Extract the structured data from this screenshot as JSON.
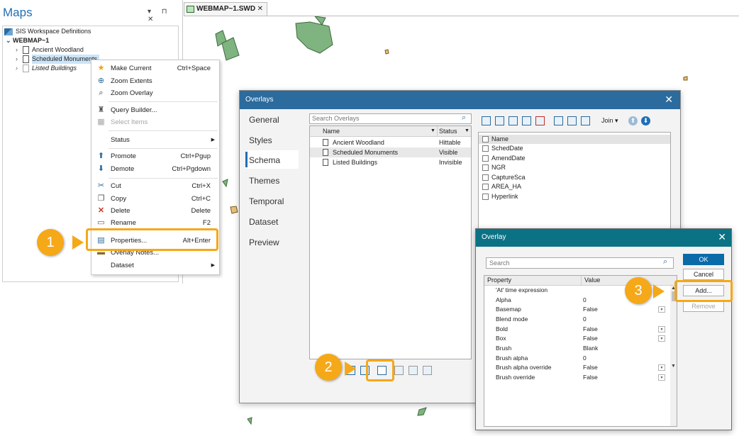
{
  "maps_panel": {
    "title": "Maps",
    "controls": "▾ ⊓ ✕",
    "tree": {
      "root": "SIS Workspace Definitions",
      "map": "WEBMAP~1",
      "items": [
        "Ancient Woodland",
        "Scheduled Monuments",
        "Listed Buildings"
      ]
    }
  },
  "map_view": {
    "tab_label": "WEBMAP~1.SWD",
    "tab_close": "✕"
  },
  "context_menu": {
    "items": [
      {
        "label": "Make Current",
        "shortcut": "Ctrl+Space",
        "icon": "★"
      },
      {
        "label": "Zoom Extents",
        "shortcut": "",
        "icon": "⊕"
      },
      {
        "label": "Zoom Overlay",
        "shortcut": "",
        "icon": "⌕"
      },
      {
        "label": "Query Builder...",
        "shortcut": "",
        "icon": "♜"
      },
      {
        "label": "Select Items",
        "shortcut": "",
        "icon": "▦"
      },
      {
        "label": "Status",
        "shortcut": "",
        "icon": ""
      },
      {
        "label": "Promote",
        "shortcut": "Ctrl+Pgup",
        "icon": "⬆"
      },
      {
        "label": "Demote",
        "shortcut": "Ctrl+Pgdown",
        "icon": "⬇"
      },
      {
        "label": "Cut",
        "shortcut": "Ctrl+X",
        "icon": "✂"
      },
      {
        "label": "Copy",
        "shortcut": "Ctrl+C",
        "icon": "❐"
      },
      {
        "label": "Delete",
        "shortcut": "Delete",
        "icon": "✕"
      },
      {
        "label": "Rename",
        "shortcut": "F2",
        "icon": "▭"
      },
      {
        "label": "Properties...",
        "shortcut": "Alt+Enter",
        "icon": "▤"
      },
      {
        "label": "Overlay Notes...",
        "shortcut": "",
        "icon": "▬"
      },
      {
        "label": "Dataset",
        "shortcut": "",
        "icon": ""
      }
    ]
  },
  "overlays_dialog": {
    "title": "Overlays",
    "close": "✕",
    "nav": [
      "General",
      "Styles",
      "Schema",
      "Themes",
      "Temporal",
      "Dataset",
      "Preview"
    ],
    "search_placeholder": "Search Overlays",
    "columns": [
      "Name",
      "Status"
    ],
    "rows": [
      {
        "name": "Ancient Woodland",
        "status": "Hittable"
      },
      {
        "name": "Scheduled Monuments",
        "status": "Visible"
      },
      {
        "name": "Listed Buildings",
        "status": "Invisible"
      }
    ],
    "join_label": "Join",
    "fields": [
      "Name",
      "SchedDate",
      "AmendDate",
      "NGR",
      "CaptureSca",
      "AREA_HA",
      "Hyperlink"
    ]
  },
  "overlay_dialog": {
    "title": "Overlay",
    "close": "✕",
    "search_placeholder": "Search",
    "columns": [
      "Property",
      "Value"
    ],
    "properties": [
      {
        "name": "'At' time expression",
        "value": "",
        "dropdown": false
      },
      {
        "name": "Alpha",
        "value": "0",
        "dropdown": false
      },
      {
        "name": "Basemap",
        "value": "False",
        "dropdown": true
      },
      {
        "name": "Blend mode",
        "value": "0",
        "dropdown": false
      },
      {
        "name": "Bold",
        "value": "False",
        "dropdown": true
      },
      {
        "name": "Box",
        "value": "False",
        "dropdown": true
      },
      {
        "name": "Brush",
        "value": "Blank",
        "dropdown": false
      },
      {
        "name": "Brush alpha",
        "value": "0",
        "dropdown": false
      },
      {
        "name": "Brush alpha override",
        "value": "False",
        "dropdown": true
      },
      {
        "name": "Brush override",
        "value": "False",
        "dropdown": true
      }
    ],
    "buttons": {
      "ok": "OK",
      "cancel": "Cancel",
      "add": "Add...",
      "remove": "Remove"
    }
  },
  "callouts": [
    "1",
    "2",
    "3"
  ],
  "colors": {
    "accent": "#f5a818",
    "title_blue": "#2b6b9e",
    "title_teal": "#0b7285",
    "map_green": "#7fb37f"
  }
}
